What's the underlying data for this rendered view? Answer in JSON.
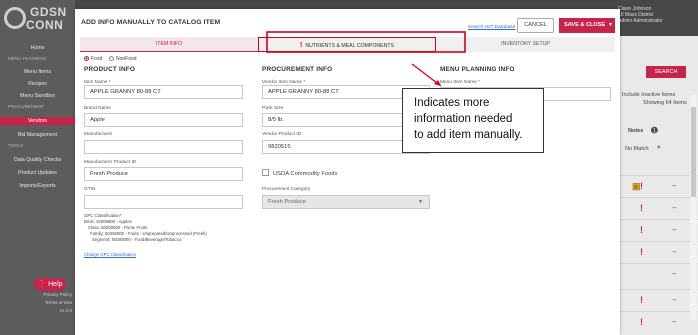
{
  "background": {
    "logo_line1": "GDSN",
    "logo_line2": "CONN",
    "nav": [
      {
        "label": "Home",
        "kind": "item"
      },
      {
        "label": "MENU PLANNING",
        "kind": "section"
      },
      {
        "label": "Menu Items",
        "kind": "item"
      },
      {
        "label": "Recipes",
        "kind": "item"
      },
      {
        "label": "Menu Sandbox",
        "kind": "item"
      },
      {
        "label": "PROCUREMENT",
        "kind": "section"
      },
      {
        "label": "Vendors",
        "kind": "active"
      },
      {
        "label": "Bid Management",
        "kind": "item"
      },
      {
        "label": "TOOLS",
        "kind": "section"
      },
      {
        "label": "Data Quality Checks",
        "kind": "item"
      },
      {
        "label": "Product Updates",
        "kind": "item"
      },
      {
        "label": "Imports/Exports",
        "kind": "item"
      }
    ],
    "help_label": "Help",
    "footer": [
      "Privacy Policy",
      "Terms of Use",
      "v1.0.0"
    ],
    "user_name": "Claire Johnson",
    "user_org": "10 Mass District",
    "user_role": "Admin Administrator",
    "search_label": "SEARCH",
    "include_inactive": "Include Inactive Items",
    "showing": "Showing 64 Items",
    "notes_header": "Notes",
    "match_label": "No Match"
  },
  "modal": {
    "title": "ADD INFO MANUALLY TO CATALOG ITEM",
    "search_link": "Search H2T Database",
    "cancel": "CANCEL",
    "save_close": "SAVE & CLOSE",
    "tabs": [
      "ITEM INFO",
      "NUTRIENTS & MEAL COMPONENTS",
      "INVENTORY SETUP"
    ],
    "radio_food": "Food",
    "radio_nonfood": "NonFood",
    "product": {
      "heading": "PRODUCT INFO",
      "item_name_label": "Item Name *",
      "item_name": "APPLE GRANNY 80-88 CT",
      "brand_label": "Brand Name",
      "brand": "Apple",
      "manufacturer_label": "Manufacturer",
      "manufacturer": "",
      "mfr_id_label": "Manufacturer Product ID",
      "mfr_id": "Fresh Produce",
      "gtin_label": "GTIN",
      "gtin": ""
    },
    "procurement": {
      "heading": "PROCUREMENT INFO",
      "vendor_name_label": "Vendor Item Name *",
      "vendor_name": "APPLE GRANNY 80-88 CT",
      "pack_size_label": "Pack Size",
      "pack_size": "8/5 lb.",
      "vendor_id_label": "Vendor Product ID",
      "vendor_id": "9820515",
      "usda_label": "USDA Commodity Foods",
      "category_label": "Procurement Category",
      "category": "Fresh Produce"
    },
    "menu": {
      "heading": "MENU PLANNING INFO",
      "menu_name_label": "Menu Item Name *"
    },
    "gpc": {
      "heading": "GPC Classification*",
      "brick": "Brick: 10005900 - Apples",
      "class": "Class: 50250600 - Pome Fruits",
      "family": "Family: 50250000 - Fruits - Unprepared/Unprocessed (Fresh)",
      "segment": "Segment: 50000000 - Food/Beverage/Tobacco",
      "change_link": "Change GPC Classification"
    }
  },
  "callout": {
    "line1": "Indicates more",
    "line2": "information needed",
    "line3": "to add item manually."
  },
  "colors": {
    "accent": "#c7244b",
    "annotation": "#d0021b"
  }
}
